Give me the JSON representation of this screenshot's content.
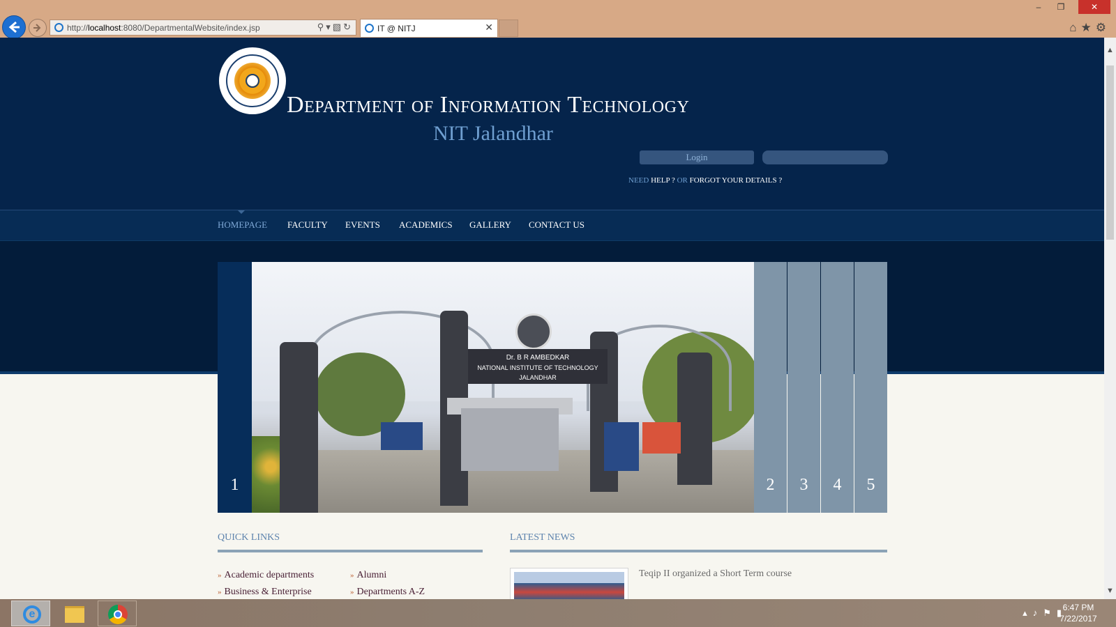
{
  "browser": {
    "url_prefix": "http://",
    "url_host": "localhost",
    "url_rest": ":8080/DepartmentalWebsite/index.jsp",
    "tab_title": "IT @ NITJ",
    "window_buttons": [
      "–",
      "❐",
      "✕"
    ],
    "toolbar_icons": [
      "home-icon",
      "favorites-icon",
      "settings-icon"
    ]
  },
  "header": {
    "title_part1": "D",
    "title_part1_sc": "epartment",
    "title_of": "of",
    "title_part2": "I",
    "title_part2_sc": "nformation",
    "title_part3": "T",
    "title_part3_sc": "echnology",
    "subtitle": "NIT Jalandhar",
    "login_label": "Login",
    "help_need": "NEED",
    "help_link": "HELP ?",
    "help_or": "OR",
    "forgot_link": "FORGOT YOUR DETAILS ?"
  },
  "nav": {
    "items": [
      "HOMEPAGE",
      "FACULTY",
      "EVENTS",
      "ACADEMICS",
      "GALLERY",
      "CONTACT US"
    ],
    "active": "HOMEPAGE"
  },
  "slider": {
    "slides": [
      "1",
      "2",
      "3",
      "4",
      "5"
    ],
    "photo_banner_line1": "Dr. B R AMBEDKAR",
    "photo_banner_line2": "NATIONAL INSTITUTE OF TECHNOLOGY JALANDHAR"
  },
  "quick_links": {
    "title": "QUICK LINKS",
    "col1": [
      "Academic departments",
      "Business & Enterprise"
    ],
    "col2": [
      "Alumni",
      "Departments A-Z"
    ]
  },
  "latest_news": {
    "title": "LATEST NEWS",
    "items": [
      "Teqip II organized a Short Term course"
    ]
  },
  "taskbar": {
    "time": "6:47 PM",
    "date": "7/22/2017"
  },
  "colors": {
    "header_bg": "#05244b",
    "nav_active": "#7ea8d6",
    "slide_tab": "#7f95a8",
    "accent_link": "#4a2136"
  }
}
